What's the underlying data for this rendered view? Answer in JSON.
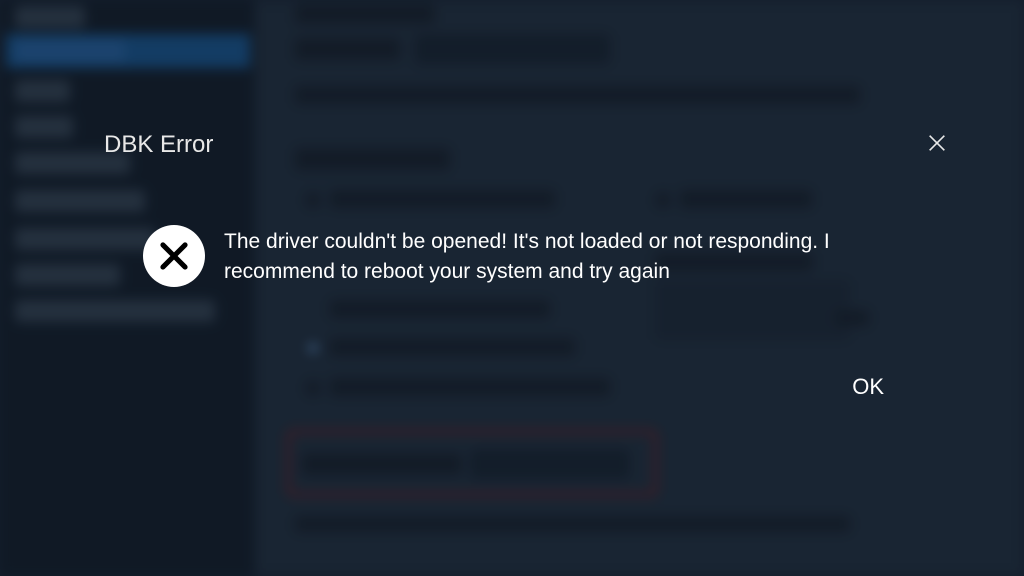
{
  "dialog": {
    "title": "DBK Error",
    "message": "The driver couldn't be opened! It's not loaded or not responding. I recommend to reboot your system and try again",
    "ok_label": "OK"
  }
}
